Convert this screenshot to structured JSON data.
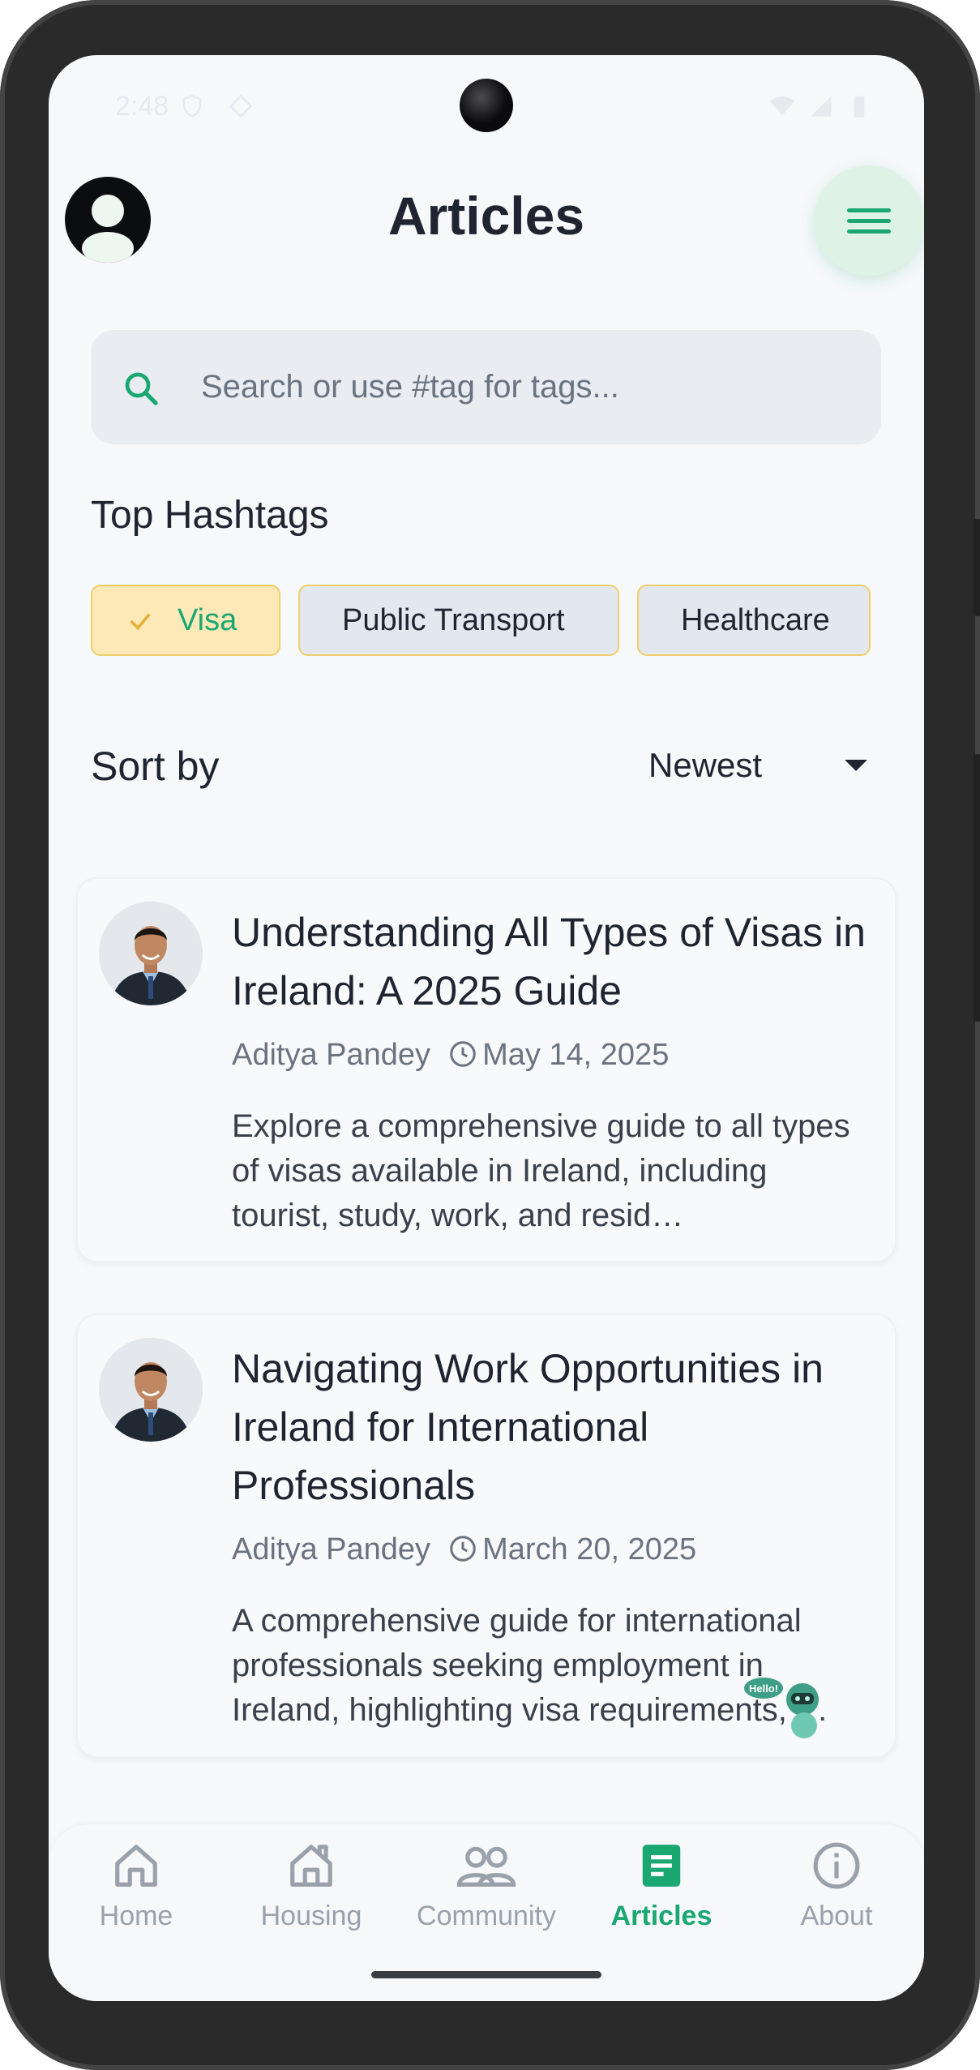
{
  "status_bar": {
    "time": "2:48",
    "icons": [
      "shield-icon",
      "location-icon",
      "wifi-icon",
      "signal-icon",
      "battery-icon"
    ]
  },
  "header": {
    "title": "Articles",
    "profile_icon": "user-avatar-icon",
    "menu_icon": "hamburger-menu-icon"
  },
  "search": {
    "placeholder": "Search or use #tag for tags...",
    "value": "",
    "icon": "search-icon"
  },
  "hashtags": {
    "section_title": "Top Hashtags",
    "items": [
      {
        "label": "Visa",
        "selected": true
      },
      {
        "label": "Public Transport",
        "selected": false
      },
      {
        "label": "Healthcare",
        "selected": false
      }
    ]
  },
  "sort": {
    "label": "Sort by",
    "selected": "Newest"
  },
  "articles": [
    {
      "title": "Understanding All Types of Visas in Ireland: A 2025 Guide",
      "author": "Aditya Pandey",
      "date": "May 14, 2025",
      "excerpt": "Explore a comprehensive guide to all types of visas available in Ireland, including tourist, study, work, and resid…"
    },
    {
      "title": "Navigating Work Opportunities in Ireland for International Professionals",
      "author": "Aditya Pandey",
      "date": "March 20, 2025",
      "excerpt": "A comprehensive guide for international professionals seeking employment in Ireland, highlighting visa requirements, …"
    }
  ],
  "assistant": {
    "bubble_text": "Hello!"
  },
  "bottom_nav": {
    "active": "Articles",
    "items": [
      {
        "label": "Home",
        "icon": "home-icon"
      },
      {
        "label": "Housing",
        "icon": "housing-icon"
      },
      {
        "label": "Community",
        "icon": "community-icon"
      },
      {
        "label": "Articles",
        "icon": "articles-icon"
      },
      {
        "label": "About",
        "icon": "info-icon"
      }
    ]
  },
  "colors": {
    "accent": "#1aa772",
    "chip_border": "#f0cf6a",
    "chip_selected_bg": "#fde9b8",
    "background": "#f6f8fa"
  }
}
